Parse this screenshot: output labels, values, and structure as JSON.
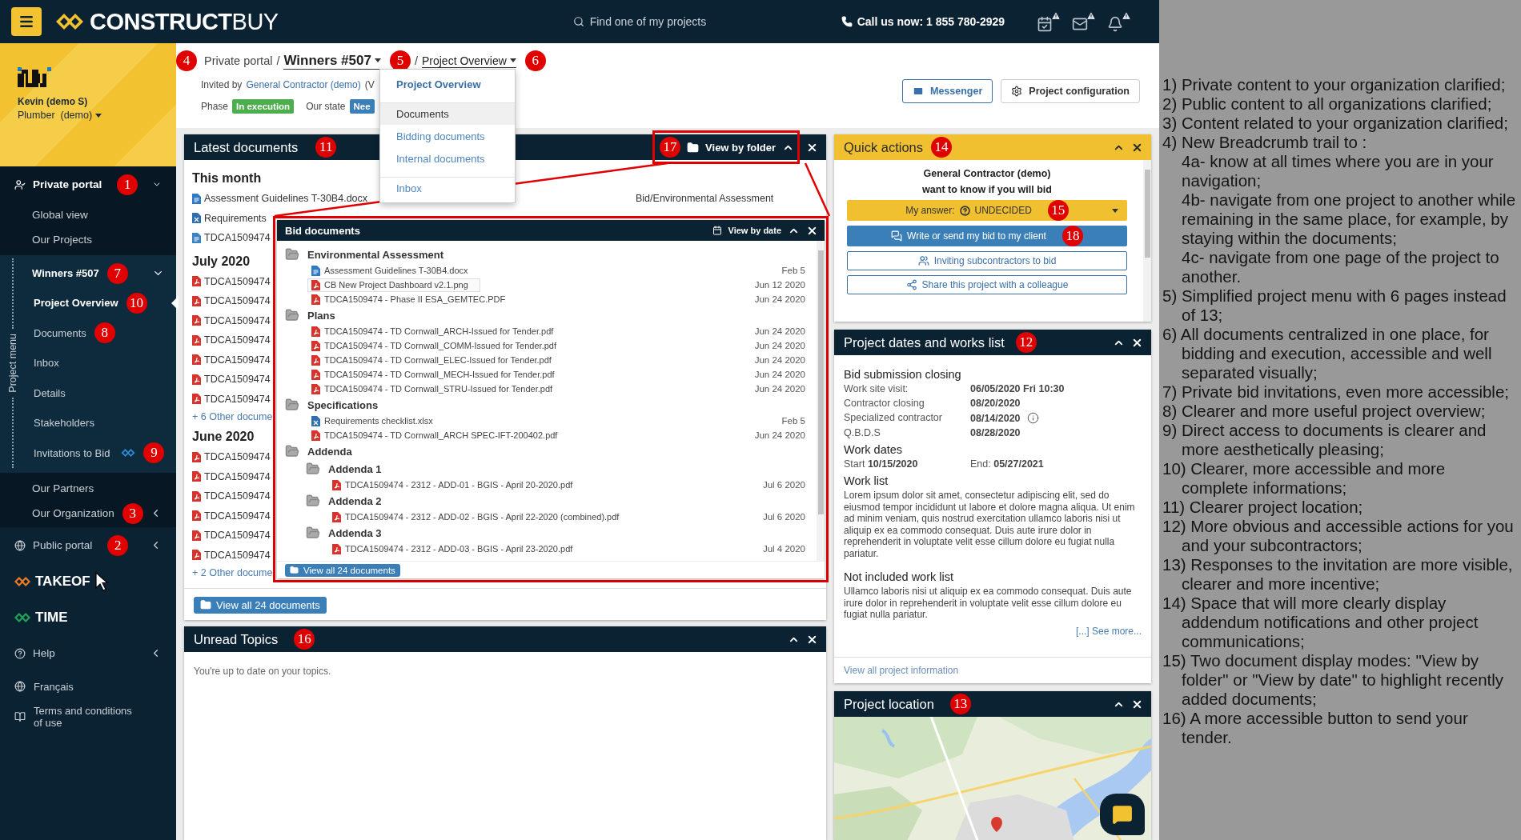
{
  "header": {
    "logo": "**CONSTRUCT**BUY",
    "search_placeholder": "Find one of my projects",
    "phone": "Call us now: 1 855 780-2929"
  },
  "sidebar": {
    "user": {
      "name": "Kevin (demo S)",
      "role": "Plumber  (demo)"
    },
    "nav": [
      {
        "kind": "section",
        "label": "Private portal",
        "expanded": true,
        "callout": "1",
        "children": [
          {
            "kind": "link",
            "label": "Global view"
          },
          {
            "kind": "link",
            "label": "Our Projects"
          },
          {
            "kind": "project",
            "label": "Winners #507",
            "expanded": true,
            "callout": "7",
            "side_label": "Project menu",
            "children": [
              {
                "label": "Project Overview",
                "selected": true,
                "callout": "10"
              },
              {
                "label": "Documents",
                "selected": false,
                "callout": "8"
              },
              {
                "label": "Inbox",
                "selected": false
              },
              {
                "label": "Details",
                "selected": false
              },
              {
                "label": "Stakeholders",
                "selected": false
              },
              {
                "label": "Invitations to Bid",
                "selected": false,
                "callout": "9"
              }
            ]
          },
          {
            "kind": "link",
            "label": "Our Partners"
          },
          {
            "kind": "link",
            "label": "Our Organization",
            "expanded": false,
            "callout": "3"
          }
        ]
      },
      {
        "kind": "section",
        "label": "Public portal",
        "expanded": false,
        "callout": "2"
      },
      {
        "kind": "brand",
        "label": "TAKEOF",
        "color": "#f07c1f",
        "hovered": true
      },
      {
        "kind": "brand",
        "label": "TIME",
        "color": "#1fa45a",
        "hovered": false
      },
      {
        "kind": "section",
        "label": "Help",
        "expanded": false
      },
      {
        "kind": "plain",
        "label": "Français"
      },
      {
        "kind": "plain",
        "label": "Terms and conditions of use"
      }
    ]
  },
  "breadcrumb": {
    "callout": "4",
    "separator": "/",
    "items": [
      {
        "kind": "text",
        "label": "Private portal"
      },
      {
        "kind": "project",
        "label": "Winners #507",
        "callout": "5"
      },
      {
        "kind": "page",
        "label": "Project Overview",
        "callout": "6"
      }
    ]
  },
  "invitation": {
    "prefix": "Invited by",
    "link": "General Contractor (demo)",
    "suffix": "(V"
  },
  "status": [
    {
      "label": "Phase",
      "value": "In execution",
      "color": "#4cae4c"
    },
    {
      "label": "Our state",
      "value": "Nee",
      "color": "#3a7fb8"
    }
  ],
  "toolbar": [
    {
      "kind": "outline",
      "label": "Messenger"
    },
    {
      "kind": "default",
      "label": "Project configuration"
    }
  ],
  "page_menu": {
    "items": [
      {
        "label": "Project Overview",
        "selected": true,
        "hovered": false,
        "divider_before": false
      },
      {
        "label": "Documents",
        "selected": false,
        "hovered": true,
        "divider_before": true
      },
      {
        "label": "Bidding documents",
        "selected": false,
        "hovered": false,
        "divider_before": false
      },
      {
        "label": "Internal documents",
        "selected": false,
        "hovered": false,
        "divider_before": false
      },
      {
        "label": "Inbox",
        "selected": false,
        "hovered": false,
        "divider_before": true
      }
    ]
  },
  "latest_documents": {
    "title": "Latest documents",
    "callout": "11",
    "view_toggle": {
      "label": "View by folder",
      "callout": "17"
    },
    "groups": [
      {
        "heading": "This month",
        "docs": [
          {
            "kind": "word",
            "name": "Assessment Guidelines T-30B4.docx",
            "folder": "Bid/Environmental Assessment"
          },
          {
            "kind": "excel",
            "name": "Requirements"
          },
          {
            "kind": "text",
            "name": "TDCA1509474"
          }
        ]
      },
      {
        "heading": "July 2020",
        "docs": [
          {
            "kind": "pdf",
            "name": "TDCA1509474"
          },
          {
            "kind": "pdf",
            "name": "TDCA1509474"
          },
          {
            "kind": "pdf",
            "name": "TDCA1509474"
          },
          {
            "kind": "pdf",
            "name": "TDCA1509474"
          },
          {
            "kind": "pdf",
            "name": "TDCA1509474"
          },
          {
            "kind": "pdf",
            "name": "TDCA1509474"
          },
          {
            "kind": "pdf",
            "name": "TDCA1509474"
          }
        ],
        "more": "+ 6 Other docume"
      },
      {
        "heading": "June 2020",
        "docs": [
          {
            "kind": "pdf",
            "name": "TDCA1509474"
          },
          {
            "kind": "pdf",
            "name": "TDCA1509474"
          },
          {
            "kind": "pdf",
            "name": "TDCA1509474"
          },
          {
            "kind": "pdf",
            "name": "TDCA1509474"
          },
          {
            "kind": "pdf",
            "name": "TDCA1509474"
          },
          {
            "kind": "pdf",
            "name": "TDCA1509474"
          }
        ],
        "more": "+ 2 Other docume"
      }
    ],
    "button": "View all 24 documents"
  },
  "bid_documents": {
    "title": "Bid documents",
    "view_toggle": "View by date",
    "folders": [
      {
        "name": "Environmental Assessment",
        "files": [
          {
            "kind": "word",
            "name": "Assessment Guidelines T-30B4.docx",
            "date": "Feb 5",
            "hovered": false
          },
          {
            "kind": "pdf",
            "name": "CB New Project Dashboard v2.1.png",
            "date": "Jun 12 2020",
            "hovered": true
          },
          {
            "kind": "pdf",
            "name": "TDCA1509474 - Phase II ESA_GEMTEC.PDF",
            "date": "Jun 24 2020",
            "hovered": false
          }
        ]
      },
      {
        "name": "Plans",
        "files": [
          {
            "kind": "pdf",
            "name": "TDCA1509474 - TD Cornwall_ARCH-Issued for Tender.pdf",
            "date": "Jun 24 2020",
            "hovered": false
          },
          {
            "kind": "pdf",
            "name": "TDCA1509474 - TD Cornwall_COMM-Issued for Tender.pdf",
            "date": "Jun 24 2020",
            "hovered": false
          },
          {
            "kind": "pdf",
            "name": "TDCA1509474 - TD Cornwall_ELEC-Issued for Tender.pdf",
            "date": "Jun 24 2020",
            "hovered": false
          },
          {
            "kind": "pdf",
            "name": "TDCA1509474 - TD Cornwall_MECH-Issued for Tender.pdf",
            "date": "Jun 24 2020",
            "hovered": false
          },
          {
            "kind": "pdf",
            "name": "TDCA1509474 - TD Cornwall_STRU-Issued for Tender.pdf",
            "date": "Jun 24 2020",
            "hovered": false
          }
        ]
      },
      {
        "name": "Specifications",
        "files": [
          {
            "kind": "excel",
            "name": "Requirements checklist.xlsx",
            "date": "Feb 5",
            "hovered": false
          },
          {
            "kind": "pdf",
            "name": "TDCA1509474 - TD Cornwall_ARCH SPEC-IFT-200402.pdf",
            "date": "Jun 24 2020",
            "hovered": false
          }
        ]
      },
      {
        "name": "Addenda",
        "children": [
          {
            "name": "Addenda 1",
            "files": [
              {
                "kind": "pdf",
                "name": "TDCA1509474 - 2312 - ADD-01 - BGIS - April 20-2020.pdf",
                "date": "Jul 6 2020",
                "hovered": false
              }
            ]
          },
          {
            "name": "Addenda 2",
            "files": [
              {
                "kind": "pdf",
                "name": "TDCA1509474 - 2312 - ADD-02 - BGIS - April 22-2020 (combined).pdf",
                "date": "Jul 6 2020",
                "hovered": false
              }
            ]
          },
          {
            "name": "Addenda 3",
            "files": [
              {
                "kind": "pdf",
                "name": "TDCA1509474 - 2312 - ADD-03 - BGIS - April 23-2020.pdf",
                "date": "Jul 4 2020",
                "hovered": false
              }
            ]
          }
        ]
      }
    ],
    "button": "View all 24 documents"
  },
  "unread_topics": {
    "title": "Unread Topics",
    "callout": "16",
    "message": "You're up to date on your topics."
  },
  "quick_actions": {
    "title": "Quick actions",
    "callout": "14",
    "message": [
      "General Contractor (demo)",
      "want to know if you will bid"
    ],
    "answer": {
      "label": "My answer:",
      "value": "UNDECIDED",
      "callout": "15"
    },
    "actions": [
      {
        "kind": "primary",
        "label": "Write or send my bid to my client",
        "callout": "18"
      },
      {
        "kind": "outline",
        "label": "Inviting subcontractors to bid"
      },
      {
        "kind": "outline",
        "label": "Share this project with a colleague"
      }
    ]
  },
  "project_dates": {
    "title": "Project dates and works list",
    "callout": "12",
    "sections": [
      {
        "kind": "table",
        "heading": "Bid submission closing",
        "rows": [
          {
            "label": "Work site visit:",
            "value": "06/05/2020 Fri 10:30",
            "info": false
          },
          {
            "label": "Contractor closing",
            "value": "08/20/2020",
            "info": false
          },
          {
            "label": "Specialized contractor",
            "value": "08/14/2020",
            "info": true
          },
          {
            "label": "Q.B.D.S",
            "value": "08/28/2020",
            "info": false
          }
        ]
      },
      {
        "kind": "range",
        "heading": "Work dates",
        "start": "Start **10/15/2020**",
        "end": "End: **05/27/2021**"
      },
      {
        "kind": "text",
        "heading": "Work list",
        "text": "Lorem ipsum dolor sit amet, consectetur adipiscing elit, sed do eiusmod tempor incididunt ut labore et dolore magna aliqua. Ut enim ad minim veniam, quis nostrud exercitation ullamco laboris nisi ut aliquip ex ea commodo consequat. Duis aute irure dolor in reprehenderit in voluptate velit esse cillum dolore eu fugiat nulla pariatur."
      },
      {
        "kind": "text",
        "heading": "Not included work list",
        "text": "Ullamco laboris nisi ut aliquip ex ea commodo consequat. Duis aute irure dolor in reprehenderit in voluptate velit esse cillum dolore eu fugiat nulla pariatur."
      }
    ],
    "see_more": "[...] See more...",
    "footer_link": "View all project information"
  },
  "project_location": {
    "title": "Project location",
    "callout": "13"
  },
  "notes": [
    {
      "text": "1) Private content to your organization clarified;"
    },
    {
      "text": "2) Public content to all organizations clarified;"
    },
    {
      "text": "3) Content related to your organization clarified;"
    },
    {
      "text": "4) New Breadcrumb trail to :",
      "children": [
        {
          "text": "4a- know at all times where you are in your navigation;"
        },
        {
          "text": "4b- navigate from one project to another while remaining in the same place, for example, by staying within the documents;"
        },
        {
          "text": "4c- navigate from one page of the project to another."
        }
      ]
    },
    {
      "text": "5) Simplified project menu with 6 pages instead of 13;"
    },
    {
      "text": "6) All documents centralized in one place, for bidding and execution, accessible and well separated visually;"
    },
    {
      "text": "7) Private bid invitations, even more accessible;"
    },
    {
      "text": "8) Clearer and more useful project overview;"
    },
    {
      "text": "9) Direct access to documents is clearer and more aesthetically pleasing;"
    },
    {
      "text": "10) Clearer, more accessible and more complete informations;"
    },
    {
      "text": "11) Clearer project location;"
    },
    {
      "text": "12) More obvious and accessible actions for you and your subcontractors;"
    },
    {
      "text": "13) Responses to the invitation are more visible, clearer and more incentive;"
    },
    {
      "text": "14) Space that will more clearly display addendum notifications and other project communications;"
    },
    {
      "text": "15) Two document display modes: \"View by folder\" or \"View by date\" to highlight recently added documents;"
    },
    {
      "text": "16) A more accessible button to send your tender."
    }
  ]
}
